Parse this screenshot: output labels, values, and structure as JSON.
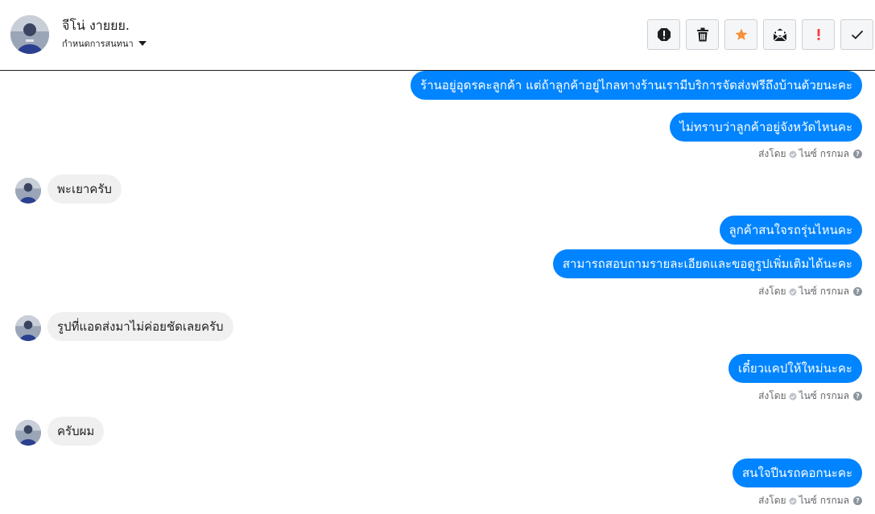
{
  "header": {
    "contact_name": "จีโน่ งายยย.",
    "assign_label": "กำหนดการสนทนา",
    "toolbar": [
      {
        "name": "spam-icon",
        "color": "#1c1e21"
      },
      {
        "name": "trash-icon",
        "color": "#1c1e21"
      },
      {
        "name": "star-icon",
        "color": "#f7923a"
      },
      {
        "name": "mark-unread-icon",
        "color": "#1c1e21"
      },
      {
        "name": "exclamation-icon",
        "color": "#fa383e"
      },
      {
        "name": "check-icon",
        "color": "#1c1e21"
      }
    ]
  },
  "messages": [
    {
      "dir": "out",
      "text": "ร้านอยู่อุดรคะลูกค้า แต่ถ้าลูกค้าอยู่ไกลทางร้านเรามีบริการจัดส่งฟรีถึงบ้านด้วยนะคะ"
    },
    {
      "dir": "out",
      "text": "ไม่ทราบว่าลูกค้าอยู่จังหวัดไหนคะ"
    },
    {
      "dir": "in",
      "text": "พะเยาครับ"
    },
    {
      "dir": "out",
      "text": "ลูกค้าสนใจรถรุ่นไหนคะ"
    },
    {
      "dir": "out",
      "text": "สามารถสอบถามรายละเอียดและขอดูรูปเพิ่มเติมได้นะคะ"
    },
    {
      "dir": "in",
      "text": "รูปที่แอดส่งมาไม่ค่อยชัดเลยครับ"
    },
    {
      "dir": "out",
      "text": "เดี๋ยวแคปให้ใหม่นะคะ"
    },
    {
      "dir": "in",
      "text": "ครับผม"
    },
    {
      "dir": "out",
      "text": "สนใจปีนรถคอกนะคะ"
    }
  ],
  "sent_meta": {
    "prefix": "ส่งโดย",
    "sender": "ไนซ์ กรกมล",
    "help": "?"
  },
  "colors": {
    "outgoing_bubble": "#0084ff",
    "incoming_bubble": "#f1f0f0"
  }
}
